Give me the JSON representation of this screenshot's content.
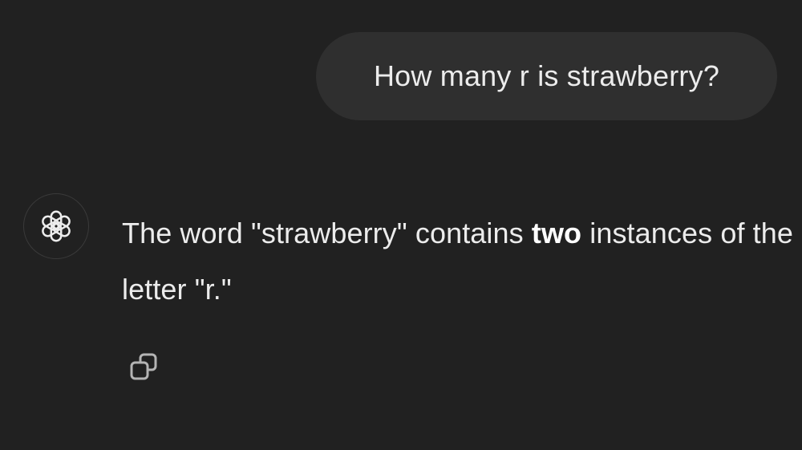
{
  "user_message": {
    "text": "How many r is strawberry?"
  },
  "assistant_message": {
    "avatar_icon": "openai-logo-icon",
    "text_before_bold": "The word \"strawberry\" contains ",
    "bold_text": "two",
    "text_after_bold": " instances of the letter \"r.\""
  },
  "actions": {
    "copy_icon": "copy-icon"
  },
  "colors": {
    "background": "#212121",
    "user_bubble": "#2f2f2f",
    "text": "#ececec",
    "icon": "#b4b4b4"
  }
}
